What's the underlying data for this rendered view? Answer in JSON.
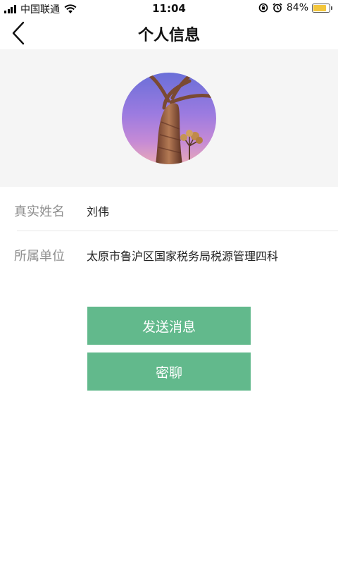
{
  "status_bar": {
    "carrier": "中国联通",
    "time": "11:04",
    "battery_percent": "84%",
    "battery_level": 0.84,
    "battery_color": "#f3c63c"
  },
  "nav": {
    "title": "个人信息",
    "back_icon": "chevron-left-icon"
  },
  "profile": {
    "fields": [
      {
        "label": "真实姓名",
        "value": "刘伟"
      },
      {
        "label": "所属单位",
        "value": "太原市鲁沪区国家税务局税源管理四科"
      }
    ]
  },
  "actions": {
    "send_message_label": "发送消息",
    "secret_chat_label": "密聊",
    "button_color": "#62b98c"
  }
}
